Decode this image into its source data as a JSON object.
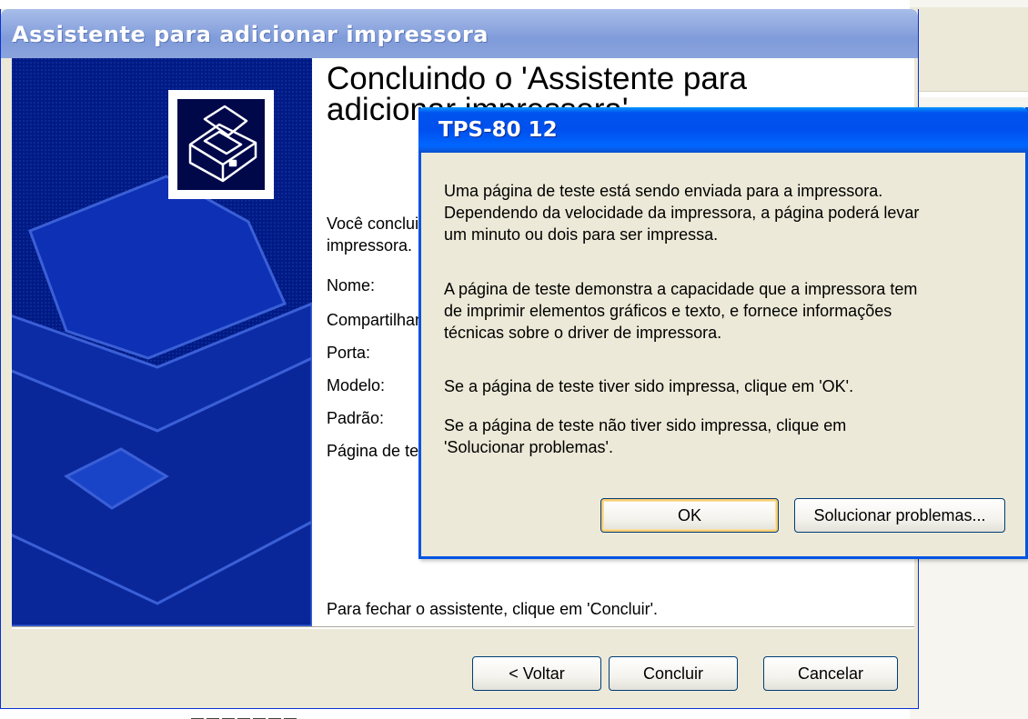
{
  "wizard": {
    "title": "Assistente para adicionar impressora",
    "heading_line1": "Concluindo o 'Assistente para",
    "heading_line2": "adicionar impressora'",
    "intro_line1": "Você concluiu com êxito o Assistente para adicionar",
    "intro_line2": "impressora.",
    "fields": {
      "name": "Nome:",
      "share": "Compartilhamento:",
      "port": "Porta:",
      "model": "Modelo:",
      "default": "Padrão:",
      "test_page": "Página de teste:"
    },
    "close_hint": "Para fechar o assistente, clique em 'Concluir'.",
    "buttons": {
      "back": "< Voltar",
      "finish": "Concluir",
      "cancel": "Cancelar"
    }
  },
  "dialog": {
    "title": "TPS-80 12",
    "para1_line1": "Uma página de teste está sendo enviada para a impressora.",
    "para1_line2": "Dependendo da velocidade da impressora, a página poderá levar",
    "para1_line3": "um minuto ou dois para ser impressa.",
    "para2_line1": "A página de teste demonstra a capacidade que a impressora tem",
    "para2_line2": "de imprimir elementos gráficos e texto, e fornece informações",
    "para2_line3": "técnicas sobre o driver de impressora.",
    "para3": "Se a página de teste tiver sido impressa, clique em 'OK'.",
    "para4_line1": "Se a página de teste não tiver sido impressa, clique em",
    "para4_line2": "'Solucionar problemas'.",
    "buttons": {
      "ok": "OK",
      "troubleshoot": "Solucionar problemas..."
    }
  },
  "icons": {
    "banner": "printer-icon",
    "banner_art": "printer-illustration"
  },
  "colors": {
    "banner_bg": "#001a85",
    "dialog_title_bg": "#0054e3",
    "wizard_title_bg": "#8ea7df",
    "button_border": "#003c74"
  }
}
